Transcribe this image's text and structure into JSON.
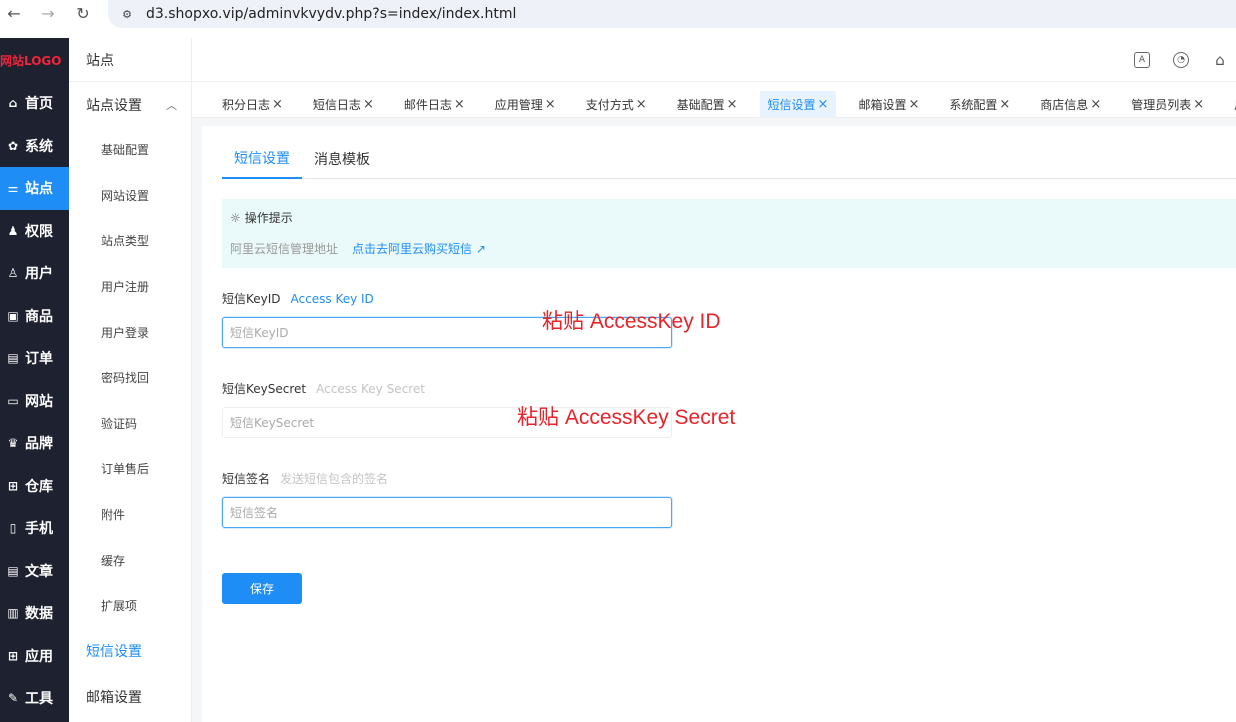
{
  "browser": {
    "url": "d3.shopxo.vip/adminvkvydv.php?s=index/index.html",
    "back_icon": "←",
    "forward_icon": "→",
    "reload_icon": "↻"
  },
  "logo": "网站LOGO",
  "main_nav": [
    {
      "label": "首页",
      "icon": "home-icon",
      "glyph": "⌂"
    },
    {
      "label": "系统",
      "icon": "gear-icon",
      "glyph": "✿"
    },
    {
      "label": "站点",
      "icon": "sliders-icon",
      "glyph": "⚌"
    },
    {
      "label": "权限",
      "icon": "user-key-icon",
      "glyph": "♟"
    },
    {
      "label": "用户",
      "icon": "user-icon",
      "glyph": "♙"
    },
    {
      "label": "商品",
      "icon": "box-icon",
      "glyph": "▣"
    },
    {
      "label": "订单",
      "icon": "order-icon",
      "glyph": "▤"
    },
    {
      "label": "网站",
      "icon": "monitor-icon",
      "glyph": "▭"
    },
    {
      "label": "品牌",
      "icon": "brand-icon",
      "glyph": "♛"
    },
    {
      "label": "仓库",
      "icon": "warehouse-icon",
      "glyph": "⊞"
    },
    {
      "label": "手机",
      "icon": "phone-icon",
      "glyph": "▯"
    },
    {
      "label": "文章",
      "icon": "article-icon",
      "glyph": "▤"
    },
    {
      "label": "数据",
      "icon": "bar-chart-icon",
      "glyph": "▥"
    },
    {
      "label": "应用",
      "icon": "apps-icon",
      "glyph": "⊞"
    },
    {
      "label": "工具",
      "icon": "wrench-icon",
      "glyph": "✎"
    }
  ],
  "sub_nav": {
    "title": "站点",
    "group_label": "站点设置",
    "group_chevron": "︿",
    "items": [
      "基础配置",
      "网站设置",
      "站点类型",
      "用户注册",
      "用户登录",
      "密码找回",
      "验证码",
      "订单售后",
      "附件",
      "缓存",
      "扩展项"
    ],
    "sms": "短信设置",
    "email": "邮箱设置"
  },
  "header_icons": [
    {
      "name": "font-icon",
      "glyph": "A"
    },
    {
      "name": "theme-icon",
      "glyph": "◔"
    },
    {
      "name": "store-icon",
      "glyph": "⌂"
    }
  ],
  "tabs": [
    {
      "label": "积分日志",
      "close": "×"
    },
    {
      "label": "短信日志",
      "close": "×"
    },
    {
      "label": "邮件日志",
      "close": "×"
    },
    {
      "label": "应用管理",
      "close": "×"
    },
    {
      "label": "支付方式",
      "close": "×"
    },
    {
      "label": "基础配置",
      "close": "×"
    },
    {
      "label": "短信设置",
      "close": "×"
    },
    {
      "label": "邮箱设置",
      "close": "×"
    },
    {
      "label": "系统配置",
      "close": "×"
    },
    {
      "label": "商店信息",
      "close": "×"
    },
    {
      "label": "管理员列表",
      "close": "×"
    },
    {
      "label": "用",
      "close": ""
    }
  ],
  "inner_tabs": [
    "短信设置",
    "消息模板"
  ],
  "tip": {
    "title": "操作提示",
    "text": "阿里云短信管理地址",
    "link": "点击去阿里云购买短信",
    "link_icon": "↗"
  },
  "form": {
    "key_id_label": "短信KeyID",
    "key_id_hint": "Access Key ID",
    "key_id_placeholder": "短信KeyID",
    "key_secret_label": "短信KeySecret",
    "key_secret_hint": "Access Key Secret",
    "key_secret_placeholder": "短信KeySecret",
    "sign_label": "短信签名",
    "sign_hint": "发送短信包含的签名",
    "sign_placeholder": "短信签名",
    "save": "保存"
  },
  "annotations": {
    "paste_id": "粘贴 AccessKey ID",
    "paste_secret": "粘贴 AccessKey Secret"
  }
}
